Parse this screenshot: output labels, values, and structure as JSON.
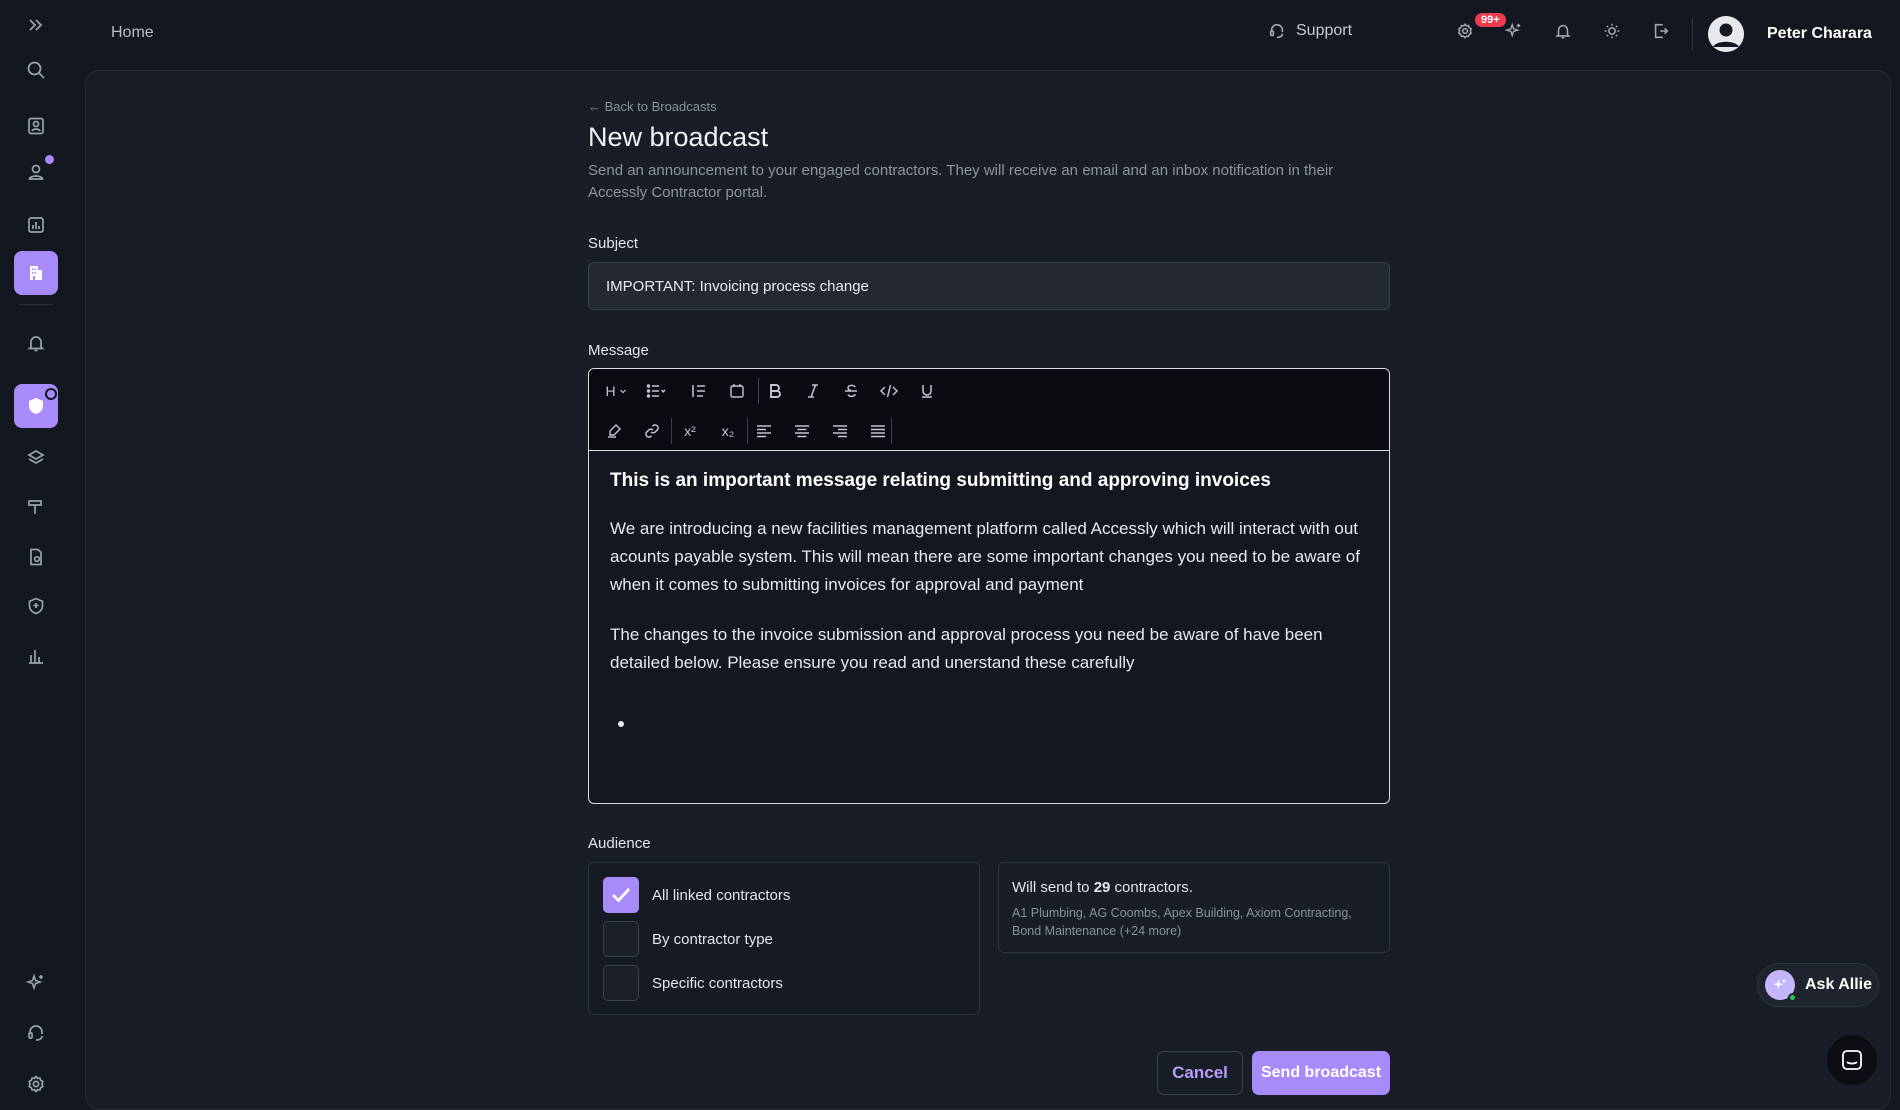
{
  "topbar": {
    "breadcrumb": "Home",
    "support_label": "Support",
    "notification_badge": "99+",
    "user_name": "Peter Charara"
  },
  "page": {
    "back_link": "← Back to Broadcasts",
    "title": "New broadcast",
    "description": "Send an announcement to your engaged contractors. They will receive an email and an inbox notification in their Accessly Contractor portal."
  },
  "form": {
    "subject_label": "Subject",
    "subject_value": "IMPORTANT: Invoicing process change",
    "message_label": "Message",
    "message_heading": "This is an important message relating submitting and approving invoices",
    "message_p1": "We are introducing a new facilities management platform called Accessly which will interact with out acounts payable system. This will mean there are some important changes you need to be aware of when it comes to submitting invoices for approval and payment",
    "message_p2": "The changes to the invoice submission and approval process you need be aware of have been detailed below. Please ensure you read and unerstand these carefully",
    "toolbar": {
      "heading": "H",
      "superscript": "x²",
      "subscript": "x₂"
    },
    "audience_label": "Audience",
    "audience_options": [
      {
        "label": "All linked contractors",
        "checked": true
      },
      {
        "label": "By contractor type",
        "checked": false
      },
      {
        "label": "Specific contractors",
        "checked": false
      }
    ],
    "send_summary_prefix": "Will send to ",
    "send_summary_count": "29",
    "send_summary_suffix": " contractors.",
    "send_summary_names": "A1 Plumbing, AG Coombs, Apex Building, Axiom Contracting, Bond Maintenance (+24 more)",
    "cancel_label": "Cancel",
    "send_label": "Send broadcast"
  },
  "assistant": {
    "label": "Ask Allie"
  },
  "colors": {
    "accent": "#a78bfa",
    "badge": "#ef3b4f",
    "background": "#131720",
    "panel": "#181d27"
  }
}
